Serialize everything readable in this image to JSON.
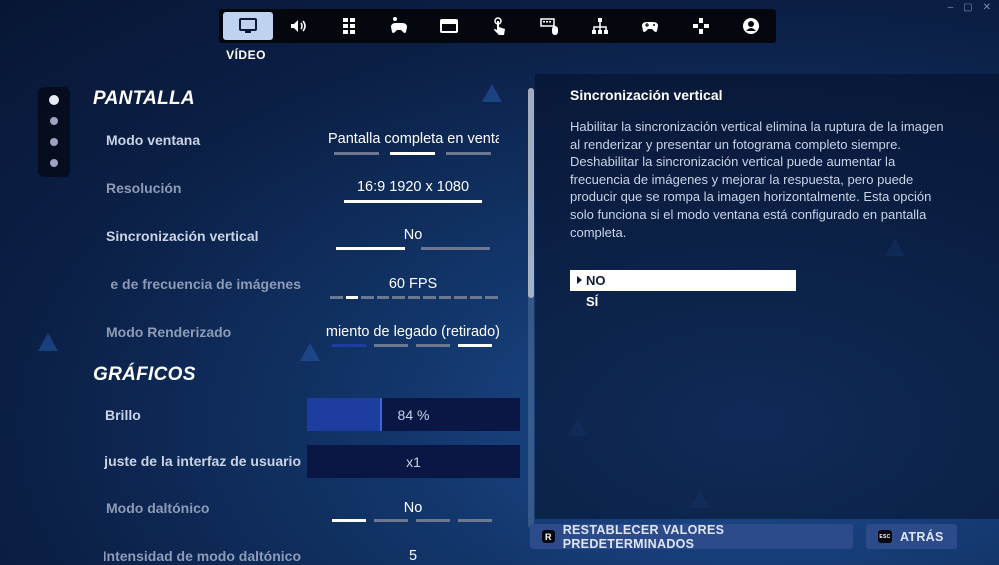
{
  "window_controls": [
    "–",
    "▢",
    "✕"
  ],
  "nav": {
    "tabs": [
      {
        "icon": "monitor-icon",
        "active": true
      },
      {
        "icon": "speaker-icon"
      },
      {
        "icon": "grid-icon"
      },
      {
        "icon": "gamepad-accessibility-icon"
      },
      {
        "icon": "card-icon"
      },
      {
        "icon": "touch-icon"
      },
      {
        "icon": "keyboard-mouse-icon"
      },
      {
        "icon": "network-icon"
      },
      {
        "icon": "controller-icon"
      },
      {
        "icon": "dpad-icon"
      },
      {
        "icon": "account-icon"
      }
    ],
    "active_label": "VÍDEO"
  },
  "sections": {
    "pantalla": "PANTALLA",
    "graficos": "GRÁFICOS"
  },
  "settings": {
    "modo_ventana": {
      "label": "Modo ventana",
      "value": "Pantalla completa en ventana",
      "selected_index": 1,
      "count": 3
    },
    "resolucion": {
      "label": "Resolución",
      "value": "16:9 1920 x 1080"
    },
    "vsync": {
      "label": "Sincronización vertical",
      "value": "No",
      "selected_index": 0,
      "count": 2
    },
    "fps": {
      "label": "Límite de frecuencia de imágenes",
      "value": "60 FPS",
      "selected_index": 1,
      "count": 11
    },
    "render": {
      "label": "Modo Renderizado",
      "value": "Rendimiento de legado (retirado)",
      "selected_index": 3,
      "count": 4
    },
    "brillo": {
      "label": "Brillo",
      "value": "84 %",
      "fill_fraction": 0.35
    },
    "ui_scale": {
      "label": "Ajuste de la interfaz de usuario",
      "value": "x1"
    },
    "daltonico": {
      "label": "Modo daltónico",
      "value": "No",
      "selected_index": 0,
      "count": 4
    },
    "intensidad": {
      "label": "Intensidad de modo daltónico",
      "value": "5"
    }
  },
  "detail": {
    "title": "Sincronización vertical",
    "description": "Habilitar la sincronización vertical elimina la ruptura de la imagen al renderizar y presentar un fotograma completo siempre. Deshabilitar la sincronización vertical puede aumentar la frecuencia de imágenes y mejorar la respuesta, pero puede producir que se rompa la imagen horizontalmente. Esta opción solo funciona si el modo ventana está configurado en pantalla completa.",
    "options": [
      "NO",
      "SÍ"
    ],
    "selected_option": 0
  },
  "footer": {
    "reset": {
      "key": "R",
      "label": "RESTABLECER VALORES PREDETERMINADOS"
    },
    "back": {
      "key": "ESC",
      "label": "ATRÁS"
    }
  }
}
